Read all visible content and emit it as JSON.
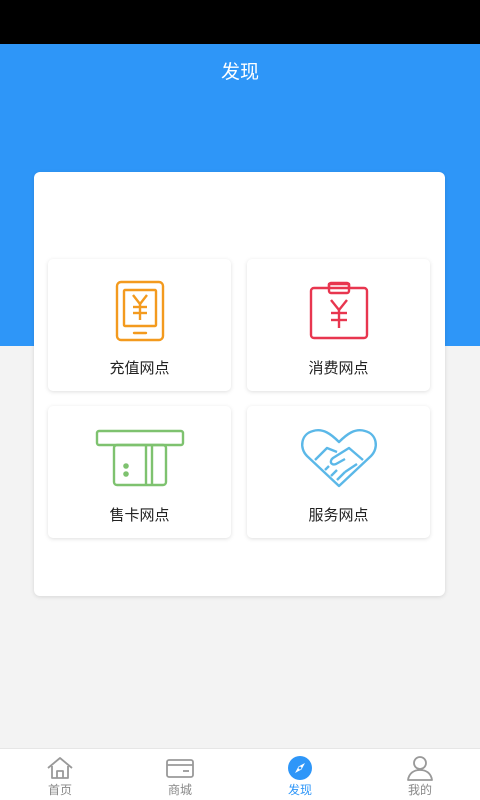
{
  "header": {
    "title": "发现"
  },
  "colors": {
    "accent": "#2e96f8",
    "recharge_icon": "#f39a1e",
    "consume_icon": "#e8364f",
    "sell_card_icon": "#7ec26f",
    "service_icon": "#5bb8e8"
  },
  "tiles": [
    {
      "label": "充值网点",
      "icon": "phone-yuan-icon"
    },
    {
      "label": "消费网点",
      "icon": "clipboard-yuan-icon"
    },
    {
      "label": "售卡网点",
      "icon": "card-slot-icon"
    },
    {
      "label": "服务网点",
      "icon": "handshake-heart-icon"
    }
  ],
  "tabbar": {
    "items": [
      {
        "label": "首页",
        "icon": "home-icon"
      },
      {
        "label": "商城",
        "icon": "wallet-icon"
      },
      {
        "label": "发现",
        "icon": "compass-icon",
        "active": true
      },
      {
        "label": "我的",
        "icon": "user-icon"
      }
    ]
  }
}
